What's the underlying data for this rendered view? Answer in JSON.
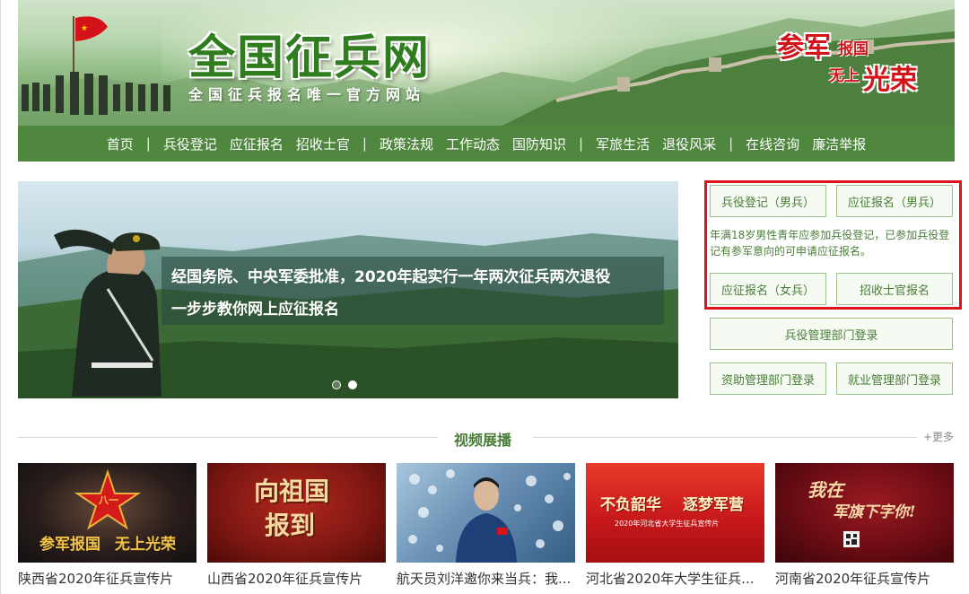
{
  "banner": {
    "title": "全国征兵网",
    "subtitle": "全国征兵报名唯一官方网站",
    "slogan_1": "参军",
    "slogan_2": "报国",
    "slogan_3": "无上",
    "slogan_4": "光荣"
  },
  "nav": {
    "items": [
      "首页",
      "兵役登记",
      "应征报名",
      "招收士官",
      "政策法规",
      "工作动态",
      "国防知识",
      "军旅生活",
      "退役风采",
      "在线咨询",
      "廉洁举报"
    ],
    "separator": "|"
  },
  "hero": {
    "line1": "经国务院、中央军委批准，2020年起实行一年两次征兵两次退役",
    "line2": "一步步教你网上应征报名",
    "slide_count": 2,
    "active_slide": 2
  },
  "panel": {
    "btn_register_male": "兵役登记（男兵）",
    "btn_apply_male": "应征报名（男兵）",
    "notice": "年满18岁男性青年应参加兵役登记，已参加兵役登记有参军意向的可申请应征报名。",
    "btn_apply_female": "应征报名（女兵）",
    "btn_nco": "招收士官报名",
    "btn_admin_login": "兵役管理部门登录",
    "btn_aid_login": "资助管理部门登录",
    "btn_employment_login": "就业管理部门登录"
  },
  "videos": {
    "section_title": "视频展播",
    "more": "+更多",
    "items": [
      {
        "caption": "陕西省2020年征兵宣传片",
        "art_text_1": "参军报国",
        "art_text_2": "无上光荣",
        "art_text_3": "八一"
      },
      {
        "caption": "山西省2020年征兵宣传片",
        "art_text_1": "向祖国",
        "art_text_2": "报到"
      },
      {
        "caption": "航天员刘洋邀你来当兵：我..."
      },
      {
        "caption": "河北省2020年大学生征兵...",
        "art_text_1": "不负韶华",
        "art_text_2": "逐梦军营",
        "art_text_3": "2020年河北省大学生征兵宣传片"
      },
      {
        "caption": "河南省2020年征兵宣传片",
        "art_text_1": "我在",
        "art_text_2": "军旗下字你!"
      }
    ]
  },
  "colors": {
    "nav_green": "#4f873f",
    "accent_green": "#4a7d38",
    "highlight_red": "#e0121a"
  }
}
